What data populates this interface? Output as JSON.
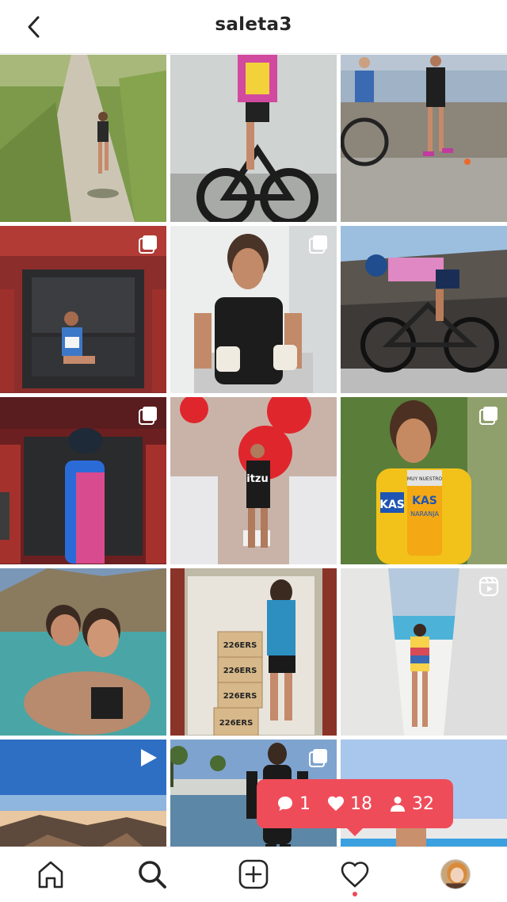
{
  "header": {
    "title": "saleta3",
    "back_icon": "chevron-left-icon"
  },
  "grid": {
    "posts": [
      {
        "type": "photo",
        "icon": null,
        "scene": "runner on gravel path"
      },
      {
        "type": "photo",
        "icon": null,
        "scene": "cyclist on time-trial bike"
      },
      {
        "type": "photo",
        "icon": null,
        "scene": "triathlon transition"
      },
      {
        "type": "carousel",
        "icon": "carousel-icon",
        "scene": "athlete in van"
      },
      {
        "type": "carousel",
        "icon": "carousel-icon",
        "scene": "athlete with jars"
      },
      {
        "type": "photo",
        "icon": null,
        "scene": "cyclist on coastal road"
      },
      {
        "type": "carousel",
        "icon": "carousel-icon",
        "scene": "cyclist at van"
      },
      {
        "type": "photo",
        "icon": null,
        "scene": "race finish with balloons"
      },
      {
        "type": "carousel",
        "icon": "carousel-icon",
        "scene": "athlete with drink can"
      },
      {
        "type": "photo",
        "icon": null,
        "scene": "couple swimming"
      },
      {
        "type": "photo",
        "icon": null,
        "scene": "athlete with boxes"
      },
      {
        "type": "reel",
        "icon": "reels-icon",
        "scene": "athlete by pool stairs"
      },
      {
        "type": "video",
        "icon": "play-icon",
        "scene": "mountain sunset"
      },
      {
        "type": "carousel",
        "icon": "carousel-icon",
        "scene": "wetsuit swimmer"
      },
      {
        "type": "photo",
        "icon": null,
        "scene": "swimmer pink cap"
      }
    ],
    "tile_labels": {
      "boxes_brand": "226ERS",
      "can_brand": "KAS",
      "can_text": "MUY NUESTRO",
      "can_flavor": "NARANJA",
      "bib_brand": "itzu"
    }
  },
  "notification": {
    "comments": "1",
    "likes": "18",
    "follows": "32",
    "comment_icon": "comment-bubble-icon",
    "like_icon": "heart-icon",
    "follow_icon": "person-icon"
  },
  "tabbar": {
    "items": [
      "home-icon",
      "search-icon",
      "new-post-icon",
      "activity-heart-icon",
      "profile-avatar"
    ],
    "active": "search-icon",
    "activity_dot_color": "#ed4956"
  },
  "colors": {
    "notification_bg": "#ef4c5a",
    "text": "#262626"
  }
}
